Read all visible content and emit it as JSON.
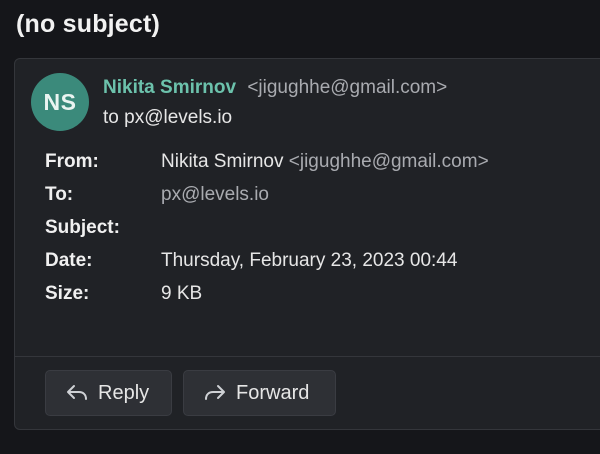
{
  "message": {
    "subject": "(no subject)",
    "sender": {
      "initials": "NS",
      "name": "Nikita Smirnov",
      "email": "<jigughhe@gmail.com>"
    },
    "to_line": "to px@levels.io"
  },
  "details": {
    "from": {
      "label": "From:",
      "name": "Nikita Smirnov",
      "email": "<jigughhe@gmail.com>"
    },
    "to": {
      "label": "To:",
      "value": "px@levels.io"
    },
    "subject": {
      "label": "Subject:",
      "value": ""
    },
    "date": {
      "label": "Date:",
      "value": "Thursday, February 23, 2023 00:44"
    },
    "size": {
      "label": "Size:",
      "value": "9 KB"
    }
  },
  "actions": {
    "reply": {
      "label": "Reply",
      "icon": "reply-arrow-icon"
    },
    "forward": {
      "label": "Forward",
      "icon": "forward-arrow-icon"
    }
  },
  "colors": {
    "background": "#15161a",
    "card": "#202226",
    "accent": "#6cc2ac",
    "avatar": "#3b8a7b"
  }
}
